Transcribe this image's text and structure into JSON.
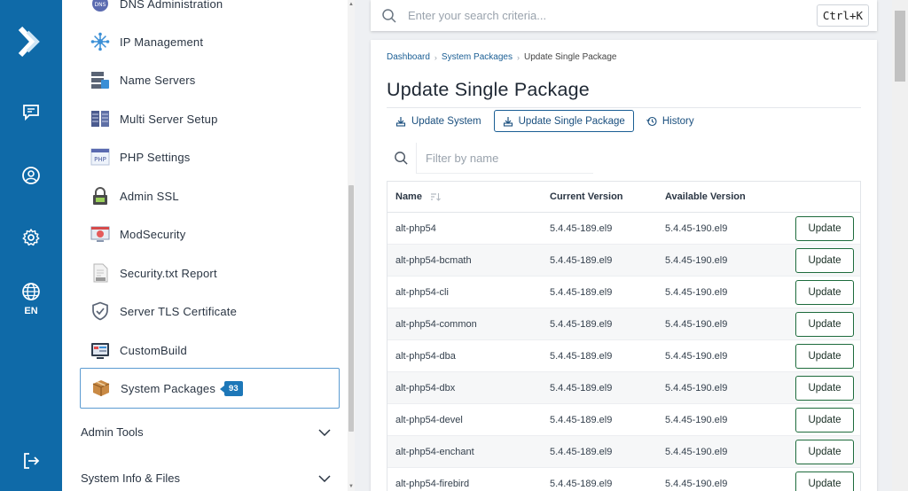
{
  "rail": {
    "language": "EN",
    "icons": [
      "brand-logo-icon",
      "chat-icon",
      "user-icon",
      "gear-icon",
      "globe-icon",
      "logout-icon"
    ]
  },
  "menu": {
    "items": [
      {
        "label": "DNS Administration",
        "icon": "dns-icon"
      },
      {
        "label": "IP Management",
        "icon": "network-icon"
      },
      {
        "label": "Name Servers",
        "icon": "name-servers-icon"
      },
      {
        "label": "Multi Server Setup",
        "icon": "multi-server-icon"
      },
      {
        "label": "PHP Settings",
        "icon": "php-icon"
      },
      {
        "label": "Admin SSL",
        "icon": "lock-icon"
      },
      {
        "label": "ModSecurity",
        "icon": "modsecurity-icon"
      },
      {
        "label": "Security.txt Report",
        "icon": "text-file-icon"
      },
      {
        "label": "Server TLS Certificate",
        "icon": "shield-icon"
      },
      {
        "label": "CustomBuild",
        "icon": "custombuild-icon"
      },
      {
        "label": "System Packages",
        "icon": "package-icon",
        "badge": "93",
        "active": true
      }
    ],
    "sections": [
      {
        "label": "Admin Tools"
      },
      {
        "label": "System Info & Files"
      }
    ]
  },
  "search": {
    "placeholder": "Enter your search criteria...",
    "shortcut": "Ctrl+K"
  },
  "breadcrumb": {
    "items": [
      "Dashboard",
      "System Packages",
      "Update Single Package"
    ]
  },
  "page": {
    "title": "Update Single Package",
    "tabs": [
      {
        "label": "Update System",
        "active": false
      },
      {
        "label": "Update Single Package",
        "active": true
      },
      {
        "label": "History",
        "active": false
      }
    ],
    "filter_placeholder": "Filter by name"
  },
  "table": {
    "headers": [
      "Name",
      "Current Version",
      "Available Version"
    ],
    "action_label": "Update",
    "rows": [
      {
        "name": "alt-php54",
        "current": "5.4.45-189.el9",
        "available": "5.4.45-190.el9"
      },
      {
        "name": "alt-php54-bcmath",
        "current": "5.4.45-189.el9",
        "available": "5.4.45-190.el9"
      },
      {
        "name": "alt-php54-cli",
        "current": "5.4.45-189.el9",
        "available": "5.4.45-190.el9"
      },
      {
        "name": "alt-php54-common",
        "current": "5.4.45-189.el9",
        "available": "5.4.45-190.el9"
      },
      {
        "name": "alt-php54-dba",
        "current": "5.4.45-189.el9",
        "available": "5.4.45-190.el9"
      },
      {
        "name": "alt-php54-dbx",
        "current": "5.4.45-189.el9",
        "available": "5.4.45-190.el9"
      },
      {
        "name": "alt-php54-devel",
        "current": "5.4.45-189.el9",
        "available": "5.4.45-190.el9"
      },
      {
        "name": "alt-php54-enchant",
        "current": "5.4.45-189.el9",
        "available": "5.4.45-190.el9"
      },
      {
        "name": "alt-php54-firebird",
        "current": "5.4.45-189.el9",
        "available": "5.4.45-190.el9"
      }
    ]
  },
  "colors": {
    "rail": "#0f6aa8",
    "link": "#1a5e94",
    "badge": "#1d77b8",
    "update_button_border": "#1d6b3c"
  }
}
